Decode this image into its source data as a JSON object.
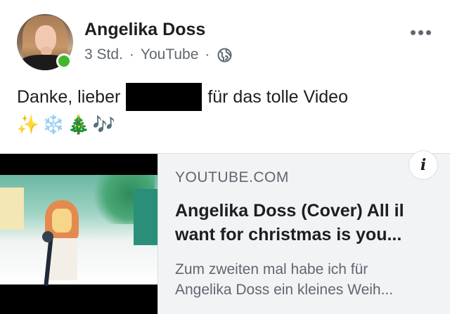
{
  "post": {
    "author": "Angelika Doss",
    "time": "3 Std.",
    "separator": "·",
    "source": "YouTube",
    "separator2": "·",
    "audience_icon": "globe-icon",
    "more_icon": "more-dots-icon",
    "text_before": "Danke, lieber",
    "text_after": "für das tolle Video",
    "emojis": [
      "✨",
      "❄️",
      "🎄",
      "🎶"
    ]
  },
  "link_card": {
    "domain": "YOUTUBE.COM",
    "title_line1": "Angelika Doss (Cover) All il",
    "title_line2": "want for christmas is you...",
    "desc_line1": "Zum zweiten mal habe ich für",
    "desc_line2": "Angelika Doss ein kleines Weih...",
    "info_label": "i"
  },
  "colors": {
    "online": "#42b72a",
    "card_bg": "#f2f3f5",
    "secondary_text": "#606770"
  }
}
